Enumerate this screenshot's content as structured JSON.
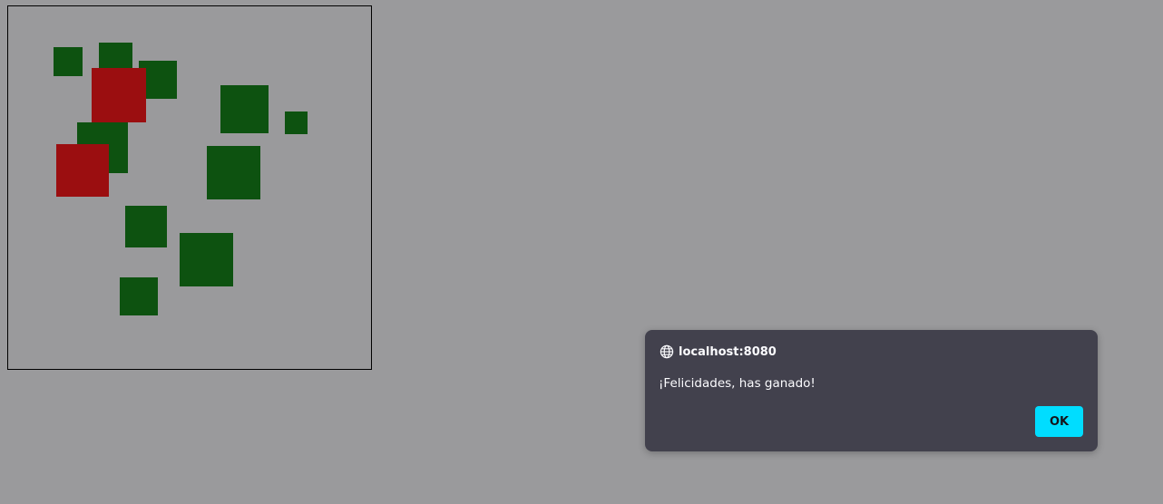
{
  "game": {
    "squares": [
      {
        "color": "green"
      },
      {
        "color": "green"
      },
      {
        "color": "green"
      },
      {
        "color": "red"
      },
      {
        "color": "green"
      },
      {
        "color": "green"
      },
      {
        "color": "green"
      },
      {
        "color": "red"
      },
      {
        "color": "green"
      },
      {
        "color": "green"
      },
      {
        "color": "green"
      },
      {
        "color": "green"
      }
    ],
    "colors": {
      "green": "#0d5210",
      "red": "#9b0e10",
      "border": "#000000"
    }
  },
  "dialog": {
    "origin": "localhost:8080",
    "icon": "globe-icon",
    "message": "¡Felicidades, has ganado!",
    "ok_label": "OK",
    "colors": {
      "background": "#42414d",
      "accent": "#00ddff",
      "text": "#fbfbfe"
    }
  },
  "page": {
    "background": "#9a9a9c"
  }
}
